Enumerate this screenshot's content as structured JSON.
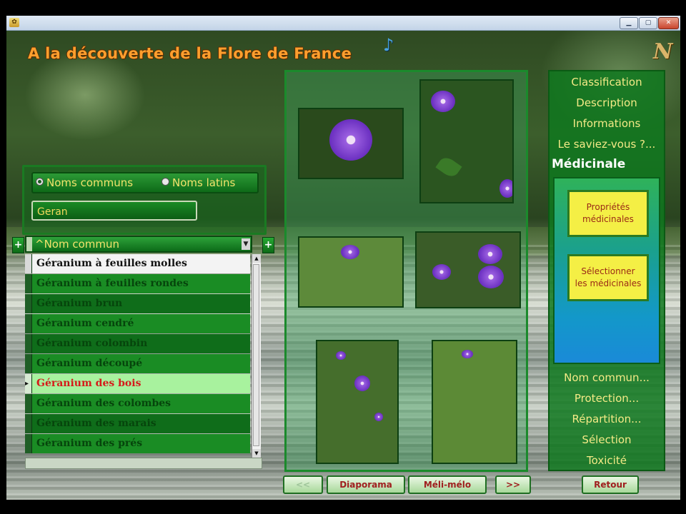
{
  "window": {
    "icon": "app-icon",
    "controls": [
      "minimize-icon",
      "maximize-icon",
      "close-icon"
    ]
  },
  "app": {
    "title": "A la découverte de la Flore de France",
    "logo": "N",
    "music_icon": "music-note-icon"
  },
  "search": {
    "radio_common": "Noms communs",
    "radio_latin": "Noms latins",
    "selected_mode": "Noms communs",
    "query": "Geran"
  },
  "list": {
    "header": "^Nom commun",
    "rows": [
      "Géranium à feuilles molles",
      "Géranium à feuilles rondes",
      "Géranium brun",
      "Géranium cendré",
      "Géranium colombin",
      "Géranium découpé",
      "Géranium des bois",
      "Géranium des colombes",
      "Géranium des marais",
      "Géranium des prés"
    ],
    "selected": "Géranium des bois"
  },
  "gallery": {
    "photos": [
      "flower-photo-1",
      "flower-photo-2",
      "flower-photo-3",
      "flower-photo-4",
      "flower-photo-5",
      "flower-photo-6"
    ]
  },
  "navigation": {
    "prev": "<<",
    "diaporama": "Diaporama",
    "meli_melo": "Méli-mélo",
    "next": ">>",
    "retour": "Retour"
  },
  "sidebar": {
    "top_items": [
      "Classification",
      "Description",
      "Informations",
      "Le saviez-vous ?..."
    ],
    "active": "Médicinale",
    "med_btn1_l1": "Propriétés",
    "med_btn1_l2": "médicinales",
    "med_btn2_l1": "Sélectionner",
    "med_btn2_l2": "les médicinales",
    "bottom_items": [
      "Nom commun...",
      "Protection...",
      "Répartition...",
      "Sélection",
      "Toxicité"
    ]
  }
}
